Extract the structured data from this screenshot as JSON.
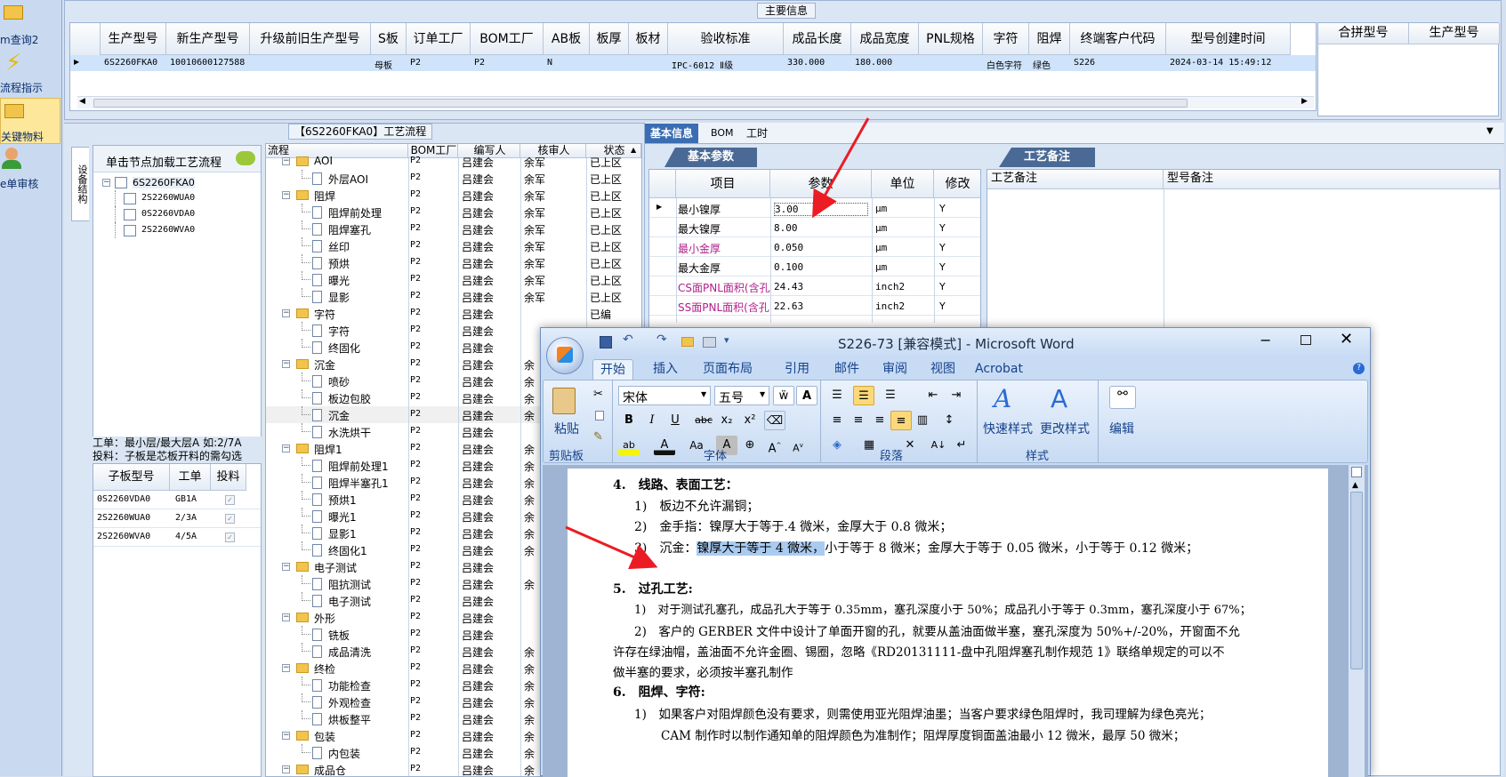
{
  "left_nav": {
    "items": [
      {
        "label": "m查询2",
        "icon": "folder-icon"
      },
      {
        "label": "流程指示",
        "icon": "lightning-icon"
      },
      {
        "label": "关键物料",
        "icon": "folder-icon"
      },
      {
        "label": "e单审核",
        "icon": "user-icon"
      }
    ]
  },
  "main_info": {
    "title": "主要信息",
    "columns": [
      "生产型号",
      "新生产型号",
      "升级前旧生产型号",
      "S板",
      "订单工厂",
      "BOM工厂",
      "AB板",
      "板厚",
      "板材",
      "验收标准",
      "成品长度",
      "成品宽度",
      "PNL规格",
      "字符",
      "阻焊",
      "终端客户代码",
      "型号创建时间"
    ],
    "row": [
      "6S2260FKA0",
      "10010600127588",
      "",
      "母板",
      "P2",
      "P2",
      "N",
      "",
      "",
      "IPC-6012 Ⅱ级",
      "330.000",
      "180.000",
      "",
      "白色字符",
      "绿色",
      "S226",
      "2024-03-14 15:49:12"
    ],
    "right_columns": [
      "合拼型号",
      "生产型号"
    ]
  },
  "process_panel": {
    "title": "【6S2260FKA0】工艺流程",
    "side_tab": "设备结构",
    "load_hint": "单击节点加载工艺流程",
    "tree": {
      "root": "6S2260FKA0",
      "children": [
        "2S2260WUA0",
        "0S2260VDA0",
        "2S2260WVA0"
      ]
    },
    "note_line1": "工单：最小层/最大层A 如:2/7A",
    "note_line2": "投料：子板是芯板开料的需勾选",
    "sub_table": {
      "columns": [
        "子板型号",
        "工单",
        "投料"
      ],
      "rows": [
        [
          "0S2260VDA0",
          "GB1A"
        ],
        [
          "2S2260WUA0",
          "2/3A"
        ],
        [
          "2S2260WVA0",
          "4/5A"
        ]
      ]
    }
  },
  "flow": {
    "columns": [
      "流程",
      "BOM工厂",
      "编写人",
      "核审人",
      "状态"
    ],
    "rows": [
      {
        "t": "f",
        "n": "AOI",
        "b": "P2",
        "w": "吕建会",
        "r": "余军",
        "s": "已上区"
      },
      {
        "t": "d",
        "n": "外层AOI",
        "b": "P2",
        "w": "吕建会",
        "r": "余军",
        "s": "已上区"
      },
      {
        "t": "f",
        "n": "阻焊",
        "b": "P2",
        "w": "吕建会",
        "r": "余军",
        "s": "已上区"
      },
      {
        "t": "d",
        "n": "阻焊前处理",
        "b": "P2",
        "w": "吕建会",
        "r": "余军",
        "s": "已上区"
      },
      {
        "t": "d",
        "n": "阻焊塞孔",
        "b": "P2",
        "w": "吕建会",
        "r": "余军",
        "s": "已上区"
      },
      {
        "t": "d",
        "n": "丝印",
        "b": "P2",
        "w": "吕建会",
        "r": "余军",
        "s": "已上区"
      },
      {
        "t": "d",
        "n": "预烘",
        "b": "P2",
        "w": "吕建会",
        "r": "余军",
        "s": "已上区"
      },
      {
        "t": "d",
        "n": "曝光",
        "b": "P2",
        "w": "吕建会",
        "r": "余军",
        "s": "已上区"
      },
      {
        "t": "d",
        "n": "显影",
        "b": "P2",
        "w": "吕建会",
        "r": "余军",
        "s": "已上区"
      },
      {
        "t": "f",
        "n": "字符",
        "b": "P2",
        "w": "吕建会",
        "r": "",
        "s": "已编"
      },
      {
        "t": "d",
        "n": "字符",
        "b": "P2",
        "w": "吕建会",
        "r": "",
        "s": ""
      },
      {
        "t": "d",
        "n": "终固化",
        "b": "P2",
        "w": "吕建会",
        "r": "",
        "s": ""
      },
      {
        "t": "f",
        "n": "沉金",
        "b": "P2",
        "w": "吕建会",
        "r": "余",
        "s": ""
      },
      {
        "t": "d",
        "n": "喷砂",
        "b": "P2",
        "w": "吕建会",
        "r": "余",
        "s": ""
      },
      {
        "t": "d",
        "n": "板边包胶",
        "b": "P2",
        "w": "吕建会",
        "r": "余",
        "s": ""
      },
      {
        "t": "d",
        "n": "沉金",
        "b": "P2",
        "w": "吕建会",
        "r": "余",
        "s": ""
      },
      {
        "t": "d",
        "n": "水洗烘干",
        "b": "P2",
        "w": "吕建会",
        "r": "",
        "s": ""
      },
      {
        "t": "f",
        "n": "阻焊1",
        "b": "P2",
        "w": "吕建会",
        "r": "余",
        "s": ""
      },
      {
        "t": "d",
        "n": "阻焊前处理1",
        "b": "P2",
        "w": "吕建会",
        "r": "余",
        "s": ""
      },
      {
        "t": "d",
        "n": "阻焊半塞孔1",
        "b": "P2",
        "w": "吕建会",
        "r": "余",
        "s": ""
      },
      {
        "t": "d",
        "n": "预烘1",
        "b": "P2",
        "w": "吕建会",
        "r": "余",
        "s": ""
      },
      {
        "t": "d",
        "n": "曝光1",
        "b": "P2",
        "w": "吕建会",
        "r": "余",
        "s": ""
      },
      {
        "t": "d",
        "n": "显影1",
        "b": "P2",
        "w": "吕建会",
        "r": "余",
        "s": ""
      },
      {
        "t": "d",
        "n": "终固化1",
        "b": "P2",
        "w": "吕建会",
        "r": "余",
        "s": ""
      },
      {
        "t": "f",
        "n": "电子测试",
        "b": "P2",
        "w": "吕建会",
        "r": "",
        "s": ""
      },
      {
        "t": "d",
        "n": "阻抗测试",
        "b": "P2",
        "w": "吕建会",
        "r": "余",
        "s": ""
      },
      {
        "t": "d",
        "n": "电子测试",
        "b": "P2",
        "w": "吕建会",
        "r": "",
        "s": ""
      },
      {
        "t": "f",
        "n": "外形",
        "b": "P2",
        "w": "吕建会",
        "r": "",
        "s": ""
      },
      {
        "t": "d",
        "n": "铣板",
        "b": "P2",
        "w": "吕建会",
        "r": "",
        "s": ""
      },
      {
        "t": "d",
        "n": "成品清洗",
        "b": "P2",
        "w": "吕建会",
        "r": "余",
        "s": ""
      },
      {
        "t": "f",
        "n": "终检",
        "b": "P2",
        "w": "吕建会",
        "r": "余",
        "s": ""
      },
      {
        "t": "d",
        "n": "功能检查",
        "b": "P2",
        "w": "吕建会",
        "r": "余",
        "s": ""
      },
      {
        "t": "d",
        "n": "外观检查",
        "b": "P2",
        "w": "吕建会",
        "r": "余",
        "s": ""
      },
      {
        "t": "d",
        "n": "烘板整平",
        "b": "P2",
        "w": "吕建会",
        "r": "余",
        "s": ""
      },
      {
        "t": "f",
        "n": "包装",
        "b": "P2",
        "w": "吕建会",
        "r": "余",
        "s": ""
      },
      {
        "t": "d",
        "n": "内包装",
        "b": "P2",
        "w": "吕建会",
        "r": "余",
        "s": ""
      },
      {
        "t": "f",
        "n": "成品仓",
        "b": "P2",
        "w": "吕建会",
        "r": "余",
        "s": ""
      }
    ]
  },
  "basic_info": {
    "tabs": [
      "基本信息",
      "BOM",
      "工时"
    ],
    "sub_tab": "基本参数",
    "columns": [
      "项目",
      "参数",
      "单位",
      "修改"
    ],
    "rows": [
      [
        "最小镍厚",
        "3.00",
        "μm",
        "Y"
      ],
      [
        "最大镍厚",
        "8.00",
        "μm",
        "Y"
      ],
      [
        "最小金厚",
        "0.050",
        "μm",
        "Y"
      ],
      [
        "最大金厚",
        "0.100",
        "μm",
        "Y"
      ],
      [
        "CS面PNL面积(含孔)",
        "24.43",
        "inch2",
        "Y"
      ],
      [
        "SS面PNL面积(含孔)",
        "22.63",
        "inch2",
        "Y"
      ]
    ]
  },
  "process_notes": {
    "tab": "工艺备注",
    "columns": [
      "工艺备注",
      "型号备注"
    ]
  },
  "word": {
    "title": "S226-73 [兼容模式] - Microsoft Word",
    "tabs": [
      "开始",
      "插入",
      "页面布局",
      "引用",
      "邮件",
      "审阅",
      "视图",
      "Acrobat"
    ],
    "font_name": "宋体",
    "font_size": "五号",
    "groups": [
      "剪贴板",
      "字体",
      "段落",
      "样式"
    ],
    "paste": "粘贴",
    "quick_style": "快速样式",
    "change_style": "更改样式",
    "edit": "编辑",
    "doc": {
      "h4": "4.　线路、表面工艺：",
      "l1": "1)　板边不允许漏铜；",
      "l2": "2)　金手指：镍厚大于等于.4 微米，金厚大于 0.8 微米；",
      "l3a": "3)　沉金：",
      "l3b": "镍厚大于等于 4 微米，",
      "l3c": "小于等于 8 微米；金厚大于等于 0.05 微米，小于等于 0.12 微米；",
      "h5": "5.　过孔工艺:",
      "p1": "1)　对于测试孔塞孔，成品孔大于等于 0.35mm，塞孔深度小于 50%；成品孔小于等于 0.3mm，塞孔深度小于 67%；",
      "p2a": "2)　客户的 GERBER 文件中设计了单面开窗的孔，就要从盖油面做半塞，塞孔深度为 50%+/-20%，开窗面不允",
      "p2b": "许存在绿油帽，盖油面不允许金圈、锡圈，忽略《RD20131111-盘中孔阻焊塞孔制作规范 1》联络单规定的可以不",
      "p2c": "做半塞的要求，必须按半塞孔制作",
      "h6": "6.　阻焊、字符:",
      "q1a": "1)　如果客户对阻焊颜色没有要求，则需使用亚光阻焊油墨；当客户要求绿色阻焊时，我司理解为绿色亮光；",
      "q1b": "CAM 制作时以制作通知单的阻焊颜色为准制作；阻焊厚度铜面盖油最小 12 微米，最厚 50 微米；"
    }
  },
  "colors": {
    "header_bg": "#dbe6f4",
    "selection": "#cfe3fb",
    "word_blue": "#c7dbf4",
    "arrow": "#ec1c24",
    "highlight": "#aacbf0"
  }
}
